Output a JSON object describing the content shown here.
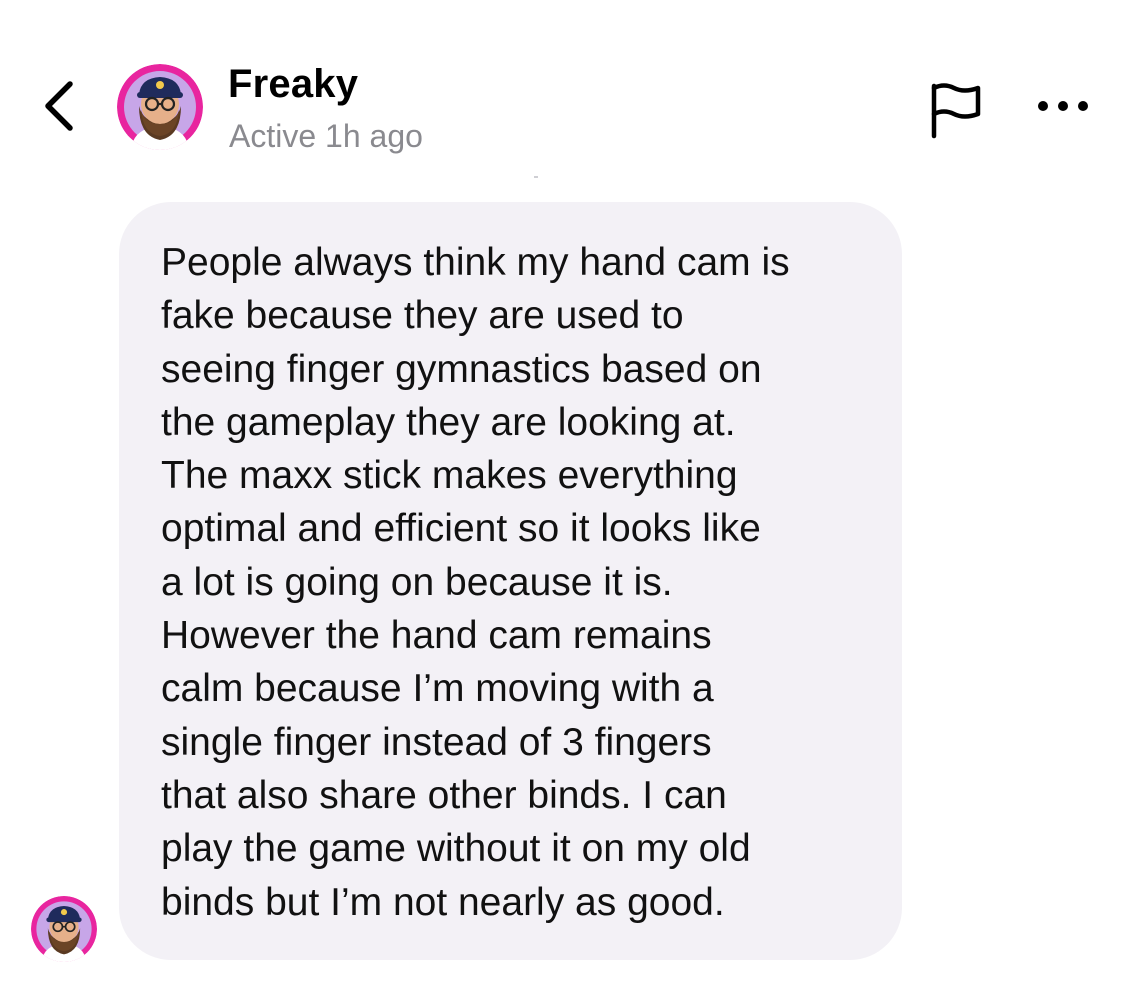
{
  "header": {
    "contact_name": "Freaky",
    "status": "Active 1h ago",
    "back_icon": "chevron-left-icon",
    "flag_icon": "flag-icon",
    "more_icon": "more-horizontal-icon"
  },
  "message": {
    "text": "People always think my hand cam is\nfake because they are used to\nseeing finger gymnastics based on\nthe gameplay they are looking at.\nThe maxx stick makes everything\noptimal and efficient so it looks like\na lot is going on because it is.\nHowever the hand cam remains\ncalm because I’m moving with a\nsingle finger instead of 3 fingers\nthat also share other binds. I can\nplay the game without it on my old\nbinds but I’m not nearly as good."
  },
  "colors": {
    "bubble_background": "#f3f1f6",
    "status_text": "#8a8a8f",
    "avatar_ring": "#e8259f"
  }
}
